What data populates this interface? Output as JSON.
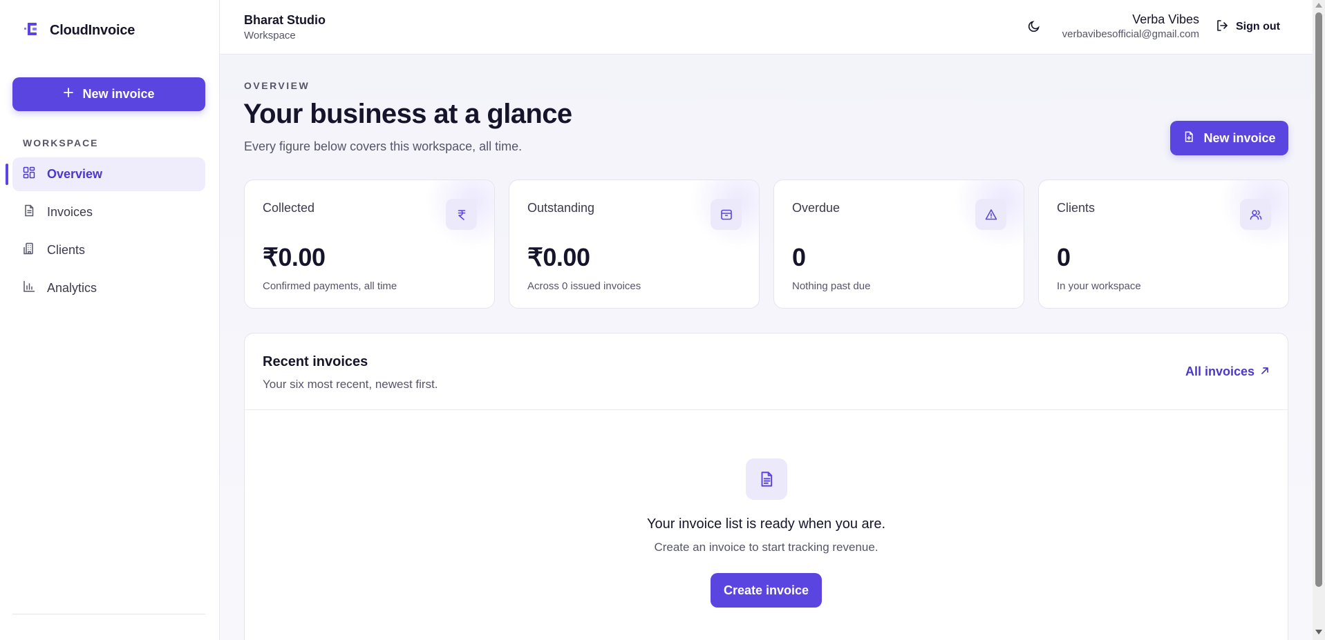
{
  "app": {
    "name": "CloudInvoice",
    "accent": "#5a45e0"
  },
  "sidebar": {
    "new_invoice_label": "New invoice",
    "section_label": "WORKSPACE",
    "items": [
      {
        "label": "Overview",
        "icon": "dashboard-icon",
        "active": true
      },
      {
        "label": "Invoices",
        "icon": "file-icon",
        "active": false
      },
      {
        "label": "Clients",
        "icon": "building-icon",
        "active": false
      },
      {
        "label": "Analytics",
        "icon": "bar-chart-icon",
        "active": false
      }
    ]
  },
  "header": {
    "workspace_name": "Bharat Studio",
    "workspace_label": "Workspace",
    "theme_icon": "moon-icon",
    "user_name": "Verba Vibes",
    "user_email": "verbavibesofficial@gmail.com",
    "sign_out_label": "Sign out"
  },
  "overview": {
    "eyebrow": "OVERVIEW",
    "title": "Your business at a glance",
    "subtitle": "Every figure below covers this workspace, all time.",
    "new_invoice_label": "New invoice"
  },
  "stats": [
    {
      "label": "Collected",
      "value": "₹0.00",
      "note": "Confirmed payments, all time",
      "icon": "rupee-icon"
    },
    {
      "label": "Outstanding",
      "value": "₹0.00",
      "note": "Across 0 issued invoices",
      "icon": "inbox-icon"
    },
    {
      "label": "Overdue",
      "value": "0",
      "note": "Nothing past due",
      "icon": "warning-icon"
    },
    {
      "label": "Clients",
      "value": "0",
      "note": "In your workspace",
      "icon": "users-icon"
    }
  ],
  "recent": {
    "title": "Recent invoices",
    "subtitle": "Your six most recent, newest first.",
    "link_label": "All invoices",
    "empty_title": "Your invoice list is ready when you are.",
    "empty_subtitle": "Create an invoice to start tracking revenue.",
    "create_label": "Create invoice"
  }
}
